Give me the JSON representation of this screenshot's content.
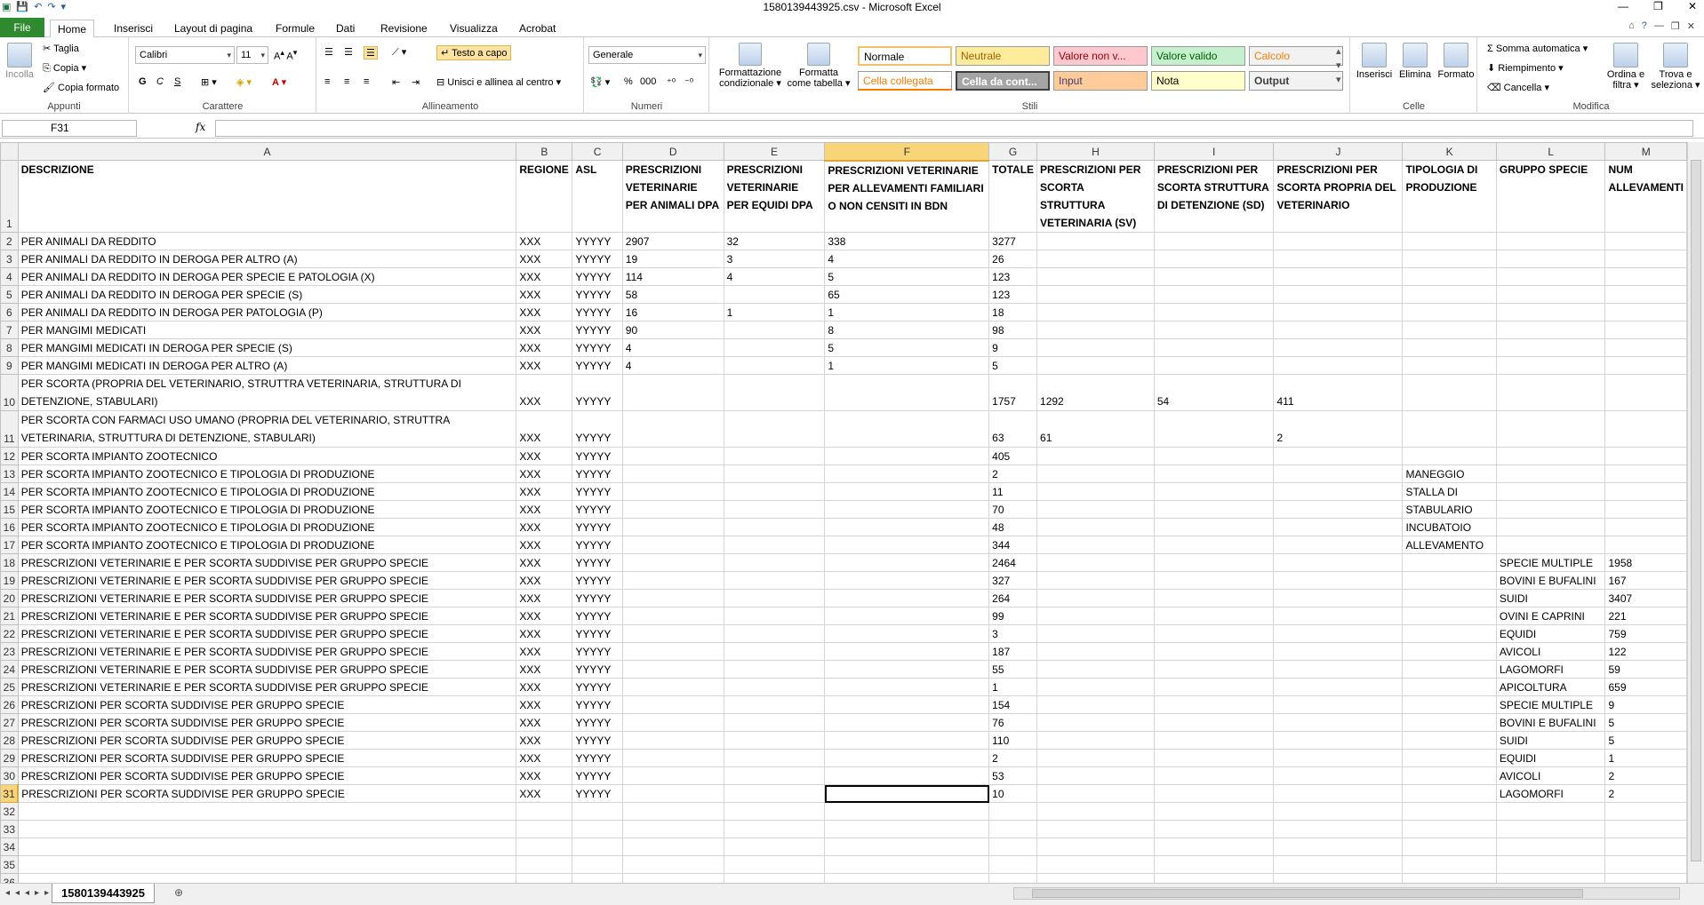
{
  "window": {
    "title": "1580139443925.csv  -  Microsoft Excel",
    "qat_icons": [
      "excel-logo-icon",
      "save-icon",
      "undo-icon",
      "redo-icon",
      "customize-icon"
    ]
  },
  "tabs": [
    {
      "label": "File"
    },
    {
      "label": "Home"
    },
    {
      "label": "Inserisci"
    },
    {
      "label": "Layout di pagina"
    },
    {
      "label": "Formule"
    },
    {
      "label": "Dati"
    },
    {
      "label": "Revisione"
    },
    {
      "label": "Visualizza"
    },
    {
      "label": "Acrobat"
    }
  ],
  "ribbon": {
    "appunti": {
      "label": "Appunti",
      "incolla": "Incolla",
      "taglia": "Taglia",
      "copia": "Copia",
      "copia_formato": "Copia formato"
    },
    "carattere": {
      "label": "Carattere",
      "font": "Calibri",
      "size": "11",
      "bold": "G",
      "italic": "C",
      "underline": "S"
    },
    "allineamento": {
      "label": "Allineamento",
      "wrap": "Testo a capo",
      "merge": "Unisci e allinea al centro"
    },
    "numeri": {
      "label": "Numeri",
      "format": "Generale",
      "percent": "%",
      "thousands": "000"
    },
    "stili": {
      "label": "Stili",
      "cond_format": "Formattazione condizionale",
      "as_table": "Formatta come tabella",
      "cells": [
        {
          "label": "Normale",
          "bg": "#ffffff",
          "fg": "#000000"
        },
        {
          "label": "Neutrale",
          "bg": "#ffeb9c",
          "fg": "#9c6500"
        },
        {
          "label": "Valore non v...",
          "bg": "#ffc7ce",
          "fg": "#9c0006"
        },
        {
          "label": "Valore valido",
          "bg": "#c6efce",
          "fg": "#006100"
        },
        {
          "label": "Calcolo",
          "bg": "#f2f2f2",
          "fg": "#fa7d00"
        },
        {
          "label": "Cella collegata",
          "bg": "#ffffff",
          "fg": "#fa7d00"
        },
        {
          "label": "Cella da cont...",
          "bg": "#a5a5a5",
          "fg": "#ffffff"
        },
        {
          "label": "Input",
          "bg": "#ffcc99",
          "fg": "#3f3f76"
        },
        {
          "label": "Nota",
          "bg": "#ffffcc",
          "fg": "#000000"
        },
        {
          "label": "Output",
          "bg": "#f2f2f2",
          "fg": "#3f3f3f"
        }
      ]
    },
    "celle": {
      "label": "Celle",
      "inserisci": "Inserisci",
      "elimina": "Elimina",
      "formato": "Formato"
    },
    "modifica": {
      "label": "Modifica",
      "somma": "Somma automatica",
      "riempimento": "Riempimento",
      "cancella": "Cancella",
      "ordina": "Ordina e filtra",
      "trova": "Trova e seleziona"
    }
  },
  "formula_bar": {
    "name_box": "F31",
    "fx": "fx",
    "value": ""
  },
  "grid": {
    "columns": [
      {
        "letter": "A",
        "width": 566
      },
      {
        "letter": "B",
        "width": 63
      },
      {
        "letter": "C",
        "width": 57
      },
      {
        "letter": "D",
        "width": 115
      },
      {
        "letter": "E",
        "width": 115
      },
      {
        "letter": "F",
        "width": 190
      },
      {
        "letter": "G",
        "width": 53
      },
      {
        "letter": "H",
        "width": 134
      },
      {
        "letter": "I",
        "width": 137
      },
      {
        "letter": "J",
        "width": 148
      },
      {
        "letter": "K",
        "width": 106
      },
      {
        "letter": "L",
        "width": 123
      },
      {
        "letter": "M",
        "width": 90
      }
    ],
    "selected_column": "F",
    "selected_row": 31,
    "active_cell": "F31",
    "rows": [
      {
        "n": 1,
        "h": 60,
        "bold": true,
        "cells": [
          "DESCRIZIONE",
          "REGIONE",
          "ASL",
          "PRESCRIZIONI VETERINARIE PER ANIMALI DPA",
          "PRESCRIZIONI VETERINARIE PER EQUIDI DPA",
          "PRESCRIZIONI VETERINARIE PER ALLEVAMENTI FAMILIARI O NON CENSITI IN BDN",
          "TOTALE",
          "PRESCRIZIONI PER SCORTA STRUTTURA VETERINARIA (SV)",
          "PRESCRIZIONI PER SCORTA STRUTTURA DI DETENZIONE (SD)",
          "PRESCRIZIONI PER SCORTA PROPRIA DEL VETERINARIO",
          "TIPOLOGIA DI PRODUZIONE",
          "GRUPPO SPECIE",
          "NUM ALLEVAMENTI"
        ]
      },
      {
        "n": 2,
        "cells": [
          "PER ANIMALI DA REDDITO",
          "XXX",
          "YYYYY",
          "2907",
          "32",
          "338",
          "3277",
          "",
          "",
          "",
          "",
          "",
          ""
        ]
      },
      {
        "n": 3,
        "cells": [
          "PER ANIMALI DA REDDITO IN DEROGA PER ALTRO (A)",
          "XXX",
          "YYYYY",
          "19",
          "3",
          "4",
          "26",
          "",
          "",
          "",
          "",
          "",
          ""
        ]
      },
      {
        "n": 4,
        "cells": [
          "PER ANIMALI DA REDDITO IN DEROGA PER SPECIE E PATOLOGIA (X)",
          "XXX",
          "YYYYY",
          "114",
          "4",
          "5",
          "123",
          "",
          "",
          "",
          "",
          "",
          ""
        ]
      },
      {
        "n": 5,
        "cells": [
          "PER ANIMALI DA REDDITO IN DEROGA PER SPECIE (S)",
          "XXX",
          "YYYYY",
          "58",
          "",
          "65",
          "123",
          "",
          "",
          "",
          "",
          "",
          ""
        ]
      },
      {
        "n": 6,
        "cells": [
          "PER ANIMALI DA REDDITO IN DEROGA PER PATOLOGIA (P)",
          "XXX",
          "YYYYY",
          "16",
          "1",
          "1",
          "18",
          "",
          "",
          "",
          "",
          "",
          ""
        ]
      },
      {
        "n": 7,
        "cells": [
          "PER MANGIMI MEDICATI",
          "XXX",
          "YYYYY",
          "90",
          "",
          "8",
          "98",
          "",
          "",
          "",
          "",
          "",
          ""
        ]
      },
      {
        "n": 8,
        "cells": [
          "PER MANGIMI MEDICATI IN DEROGA PER SPECIE (S)",
          "XXX",
          "YYYYY",
          "4",
          "",
          "5",
          "9",
          "",
          "",
          "",
          "",
          "",
          ""
        ]
      },
      {
        "n": 9,
        "cells": [
          "PER MANGIMI MEDICATI IN DEROGA PER ALTRO (A)",
          "XXX",
          "YYYYY",
          "4",
          "",
          "1",
          "5",
          "",
          "",
          "",
          "",
          "",
          ""
        ]
      },
      {
        "n": 10,
        "h": 40,
        "cells": [
          "PER SCORTA (PROPRIA DEL VETERINARIO, STRUTTRA VETERINARIA, STRUTTURA DI DETENZIONE, STABULARI)",
          "XXX",
          "YYYYY",
          "",
          "",
          "",
          "1757",
          "1292",
          "54",
          "411",
          "",
          "",
          ""
        ]
      },
      {
        "n": 11,
        "h": 40,
        "cells": [
          "PER SCORTA CON FARMACI USO UMANO (PROPRIA DEL VETERINARIO, STRUTTRA VETERINARIA, STRUTTURA DI DETENZIONE, STABULARI)",
          "XXX",
          "YYYYY",
          "",
          "",
          "",
          "63",
          "61",
          "",
          "2",
          "",
          "",
          ""
        ]
      },
      {
        "n": 12,
        "cells": [
          "PER SCORTA IMPIANTO ZOOTECNICO",
          "XXX",
          "YYYYY",
          "",
          "",
          "",
          "405",
          "",
          "",
          "",
          "",
          "",
          ""
        ]
      },
      {
        "n": 13,
        "cells": [
          "PER SCORTA IMPIANTO ZOOTECNICO E TIPOLOGIA DI PRODUZIONE",
          "XXX",
          "YYYYY",
          "",
          "",
          "",
          "2",
          "",
          "",
          "",
          "MANEGGIO",
          "",
          ""
        ]
      },
      {
        "n": 14,
        "cells": [
          "PER SCORTA IMPIANTO ZOOTECNICO E TIPOLOGIA DI PRODUZIONE",
          "XXX",
          "YYYYY",
          "",
          "",
          "",
          "11",
          "",
          "",
          "",
          "STALLA DI",
          "",
          ""
        ]
      },
      {
        "n": 15,
        "cells": [
          "PER SCORTA IMPIANTO ZOOTECNICO E TIPOLOGIA DI PRODUZIONE",
          "XXX",
          "YYYYY",
          "",
          "",
          "",
          "70",
          "",
          "",
          "",
          "STABULARIO",
          "",
          ""
        ]
      },
      {
        "n": 16,
        "cells": [
          "PER SCORTA IMPIANTO ZOOTECNICO E TIPOLOGIA DI PRODUZIONE",
          "XXX",
          "YYYYY",
          "",
          "",
          "",
          "48",
          "",
          "",
          "",
          "INCUBATOIO",
          "",
          ""
        ]
      },
      {
        "n": 17,
        "cells": [
          "PER SCORTA IMPIANTO ZOOTECNICO E TIPOLOGIA DI PRODUZIONE",
          "XXX",
          "YYYYY",
          "",
          "",
          "",
          "344",
          "",
          "",
          "",
          "ALLEVAMENTO",
          "",
          ""
        ]
      },
      {
        "n": 18,
        "cells": [
          "PRESCRIZIONI VETERINARIE E PER SCORTA SUDDIVISE PER GRUPPO SPECIE",
          "XXX",
          "YYYYY",
          "",
          "",
          "",
          "2464",
          "",
          "",
          "",
          "",
          "SPECIE MULTIPLE",
          "1958"
        ]
      },
      {
        "n": 19,
        "cells": [
          "PRESCRIZIONI VETERINARIE E PER SCORTA SUDDIVISE PER GRUPPO SPECIE",
          "XXX",
          "YYYYY",
          "",
          "",
          "",
          "327",
          "",
          "",
          "",
          "",
          "BOVINI E BUFALINI",
          "167"
        ]
      },
      {
        "n": 20,
        "cells": [
          "PRESCRIZIONI VETERINARIE E PER SCORTA SUDDIVISE PER GRUPPO SPECIE",
          "XXX",
          "YYYYY",
          "",
          "",
          "",
          "264",
          "",
          "",
          "",
          "",
          "SUIDI",
          "3407"
        ]
      },
      {
        "n": 21,
        "cells": [
          "PRESCRIZIONI VETERINARIE E PER SCORTA SUDDIVISE PER GRUPPO SPECIE",
          "XXX",
          "YYYYY",
          "",
          "",
          "",
          "99",
          "",
          "",
          "",
          "",
          "OVINI E CAPRINI",
          "221"
        ]
      },
      {
        "n": 22,
        "cells": [
          "PRESCRIZIONI VETERINARIE E PER SCORTA SUDDIVISE PER GRUPPO SPECIE",
          "XXX",
          "YYYYY",
          "",
          "",
          "",
          "3",
          "",
          "",
          "",
          "",
          "EQUIDI",
          "759"
        ]
      },
      {
        "n": 23,
        "cells": [
          "PRESCRIZIONI VETERINARIE E PER SCORTA SUDDIVISE PER GRUPPO SPECIE",
          "XXX",
          "YYYYY",
          "",
          "",
          "",
          "187",
          "",
          "",
          "",
          "",
          "AVICOLI",
          "122"
        ]
      },
      {
        "n": 24,
        "cells": [
          "PRESCRIZIONI VETERINARIE E PER SCORTA SUDDIVISE PER GRUPPO SPECIE",
          "XXX",
          "YYYYY",
          "",
          "",
          "",
          "55",
          "",
          "",
          "",
          "",
          "LAGOMORFI",
          "59"
        ]
      },
      {
        "n": 25,
        "cells": [
          "PRESCRIZIONI VETERINARIE E PER SCORTA SUDDIVISE PER GRUPPO SPECIE",
          "XXX",
          "YYYYY",
          "",
          "",
          "",
          "1",
          "",
          "",
          "",
          "",
          "APICOLTURA",
          "659"
        ]
      },
      {
        "n": 26,
        "cells": [
          "PRESCRIZIONI PER SCORTA SUDDIVISE PER GRUPPO SPECIE",
          "XXX",
          "YYYYY",
          "",
          "",
          "",
          "154",
          "",
          "",
          "",
          "",
          "SPECIE MULTIPLE",
          "9"
        ]
      },
      {
        "n": 27,
        "cells": [
          "PRESCRIZIONI PER SCORTA SUDDIVISE PER GRUPPO SPECIE",
          "XXX",
          "YYYYY",
          "",
          "",
          "",
          "76",
          "",
          "",
          "",
          "",
          "BOVINI E BUFALINI",
          "5"
        ]
      },
      {
        "n": 28,
        "cells": [
          "PRESCRIZIONI PER SCORTA SUDDIVISE PER GRUPPO SPECIE",
          "XXX",
          "YYYYY",
          "",
          "",
          "",
          "110",
          "",
          "",
          "",
          "",
          "SUIDI",
          "5"
        ]
      },
      {
        "n": 29,
        "cells": [
          "PRESCRIZIONI PER SCORTA SUDDIVISE PER GRUPPO SPECIE",
          "XXX",
          "YYYYY",
          "",
          "",
          "",
          "2",
          "",
          "",
          "",
          "",
          "EQUIDI",
          "1"
        ]
      },
      {
        "n": 30,
        "cells": [
          "PRESCRIZIONI PER SCORTA SUDDIVISE PER GRUPPO SPECIE",
          "XXX",
          "YYYYY",
          "",
          "",
          "",
          "53",
          "",
          "",
          "",
          "",
          "AVICOLI",
          "2"
        ]
      },
      {
        "n": 31,
        "cells": [
          "PRESCRIZIONI PER SCORTA SUDDIVISE PER GRUPPO SPECIE",
          "XXX",
          "YYYYY",
          "",
          "",
          "",
          "10",
          "",
          "",
          "",
          "",
          "LAGOMORFI",
          "2"
        ]
      },
      {
        "n": 32,
        "cells": [
          "",
          "",
          "",
          "",
          "",
          "",
          "",
          "",
          "",
          "",
          "",
          "",
          ""
        ]
      },
      {
        "n": 33,
        "cells": [
          "",
          "",
          "",
          "",
          "",
          "",
          "",
          "",
          "",
          "",
          "",
          "",
          ""
        ]
      },
      {
        "n": 34,
        "cells": [
          "",
          "",
          "",
          "",
          "",
          "",
          "",
          "",
          "",
          "",
          "",
          "",
          ""
        ]
      },
      {
        "n": 35,
        "cells": [
          "",
          "",
          "",
          "",
          "",
          "",
          "",
          "",
          "",
          "",
          "",
          "",
          ""
        ]
      },
      {
        "n": 36,
        "cells": [
          "",
          "",
          "",
          "",
          "",
          "",
          "",
          "",
          "",
          "",
          "",
          "",
          ""
        ]
      },
      {
        "n": 37,
        "cells": [
          "",
          "",
          "",
          "",
          "",
          "",
          "",
          "",
          "",
          "",
          "",
          "",
          ""
        ]
      }
    ]
  },
  "sheet_tabs": [
    {
      "label": "1580139443925"
    }
  ]
}
